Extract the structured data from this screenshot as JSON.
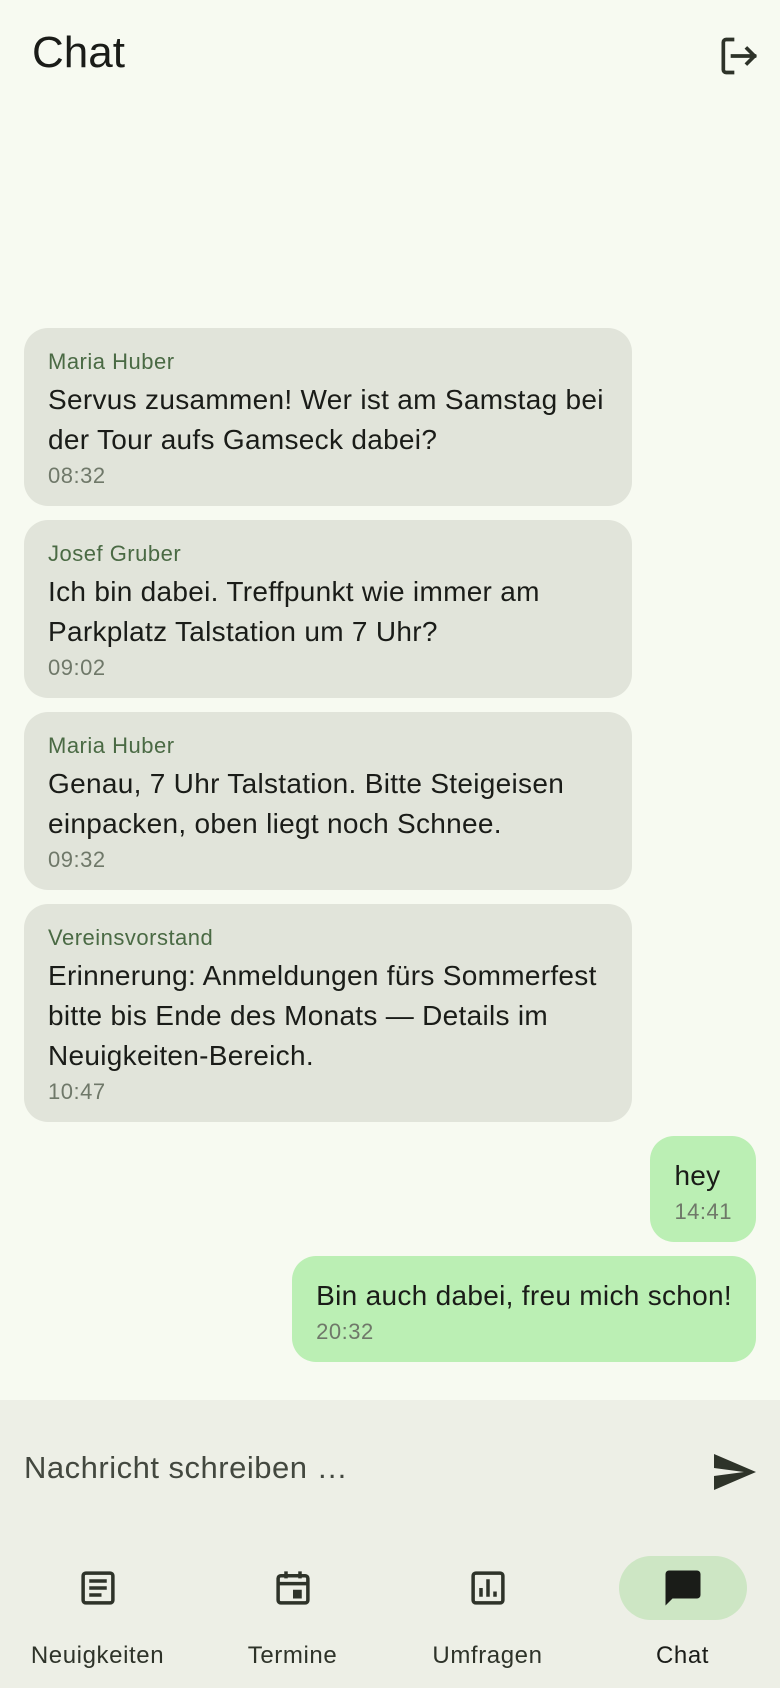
{
  "header": {
    "title": "Chat",
    "logout_icon": "logout-icon"
  },
  "messages": [
    {
      "author": "Maria Huber",
      "text": "Servus zusammen! Wer ist am Samstag bei der Tour aufs Gamseck dabei?",
      "time": "08:32",
      "own": false
    },
    {
      "author": "Josef Gruber",
      "text": "Ich bin dabei. Treffpunkt wie immer am Parkplatz Talstation um 7 Uhr?",
      "time": "09:02",
      "own": false
    },
    {
      "author": "Maria Huber",
      "text": "Genau, 7 Uhr Talstation. Bitte Steigeisen einpacken, oben liegt noch Schnee.",
      "time": "09:32",
      "own": false
    },
    {
      "author": "Vereinsvorstand",
      "text": "Erinnerung: Anmeldungen fürs Sommerfest bitte bis Ende des Monats — Details im Neuigkeiten-Bereich.",
      "time": "10:47",
      "own": false
    },
    {
      "text": "hey",
      "time": "14:41",
      "own": true
    },
    {
      "text": "Bin auch dabei, freu mich schon!",
      "time": "20:32",
      "own": true
    }
  ],
  "composer": {
    "placeholder": "Nachricht schreiben …",
    "value": "",
    "send_icon": "send-icon"
  },
  "nav": {
    "items": [
      {
        "label": "Neuigkeiten",
        "icon": "article-icon",
        "active": false
      },
      {
        "label": "Termine",
        "icon": "calendar-icon",
        "active": false
      },
      {
        "label": "Umfragen",
        "icon": "poll-icon",
        "active": false
      },
      {
        "label": "Chat",
        "icon": "chat-icon",
        "active": true
      }
    ]
  },
  "colors": {
    "background": "#f7faf1",
    "other_bubble": "#e1e4da",
    "own_bubble": "#bbefb4",
    "author": "#4a6a44",
    "nav_active_pill": "#cde6c4"
  }
}
